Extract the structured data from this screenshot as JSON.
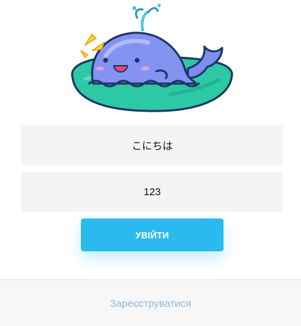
{
  "mascot": {
    "icon": "whale-on-lily-pad-illustration"
  },
  "form": {
    "username_value": "こにちは",
    "password_value": "123",
    "login_label": "УВІЙТИ"
  },
  "footer": {
    "register_label": "Зареєструватися"
  },
  "colors": {
    "accent": "#2bbaf0",
    "field_bg": "#f4f4f4",
    "link": "#8fb6d9",
    "footer_bg": "#f7f7f7"
  }
}
